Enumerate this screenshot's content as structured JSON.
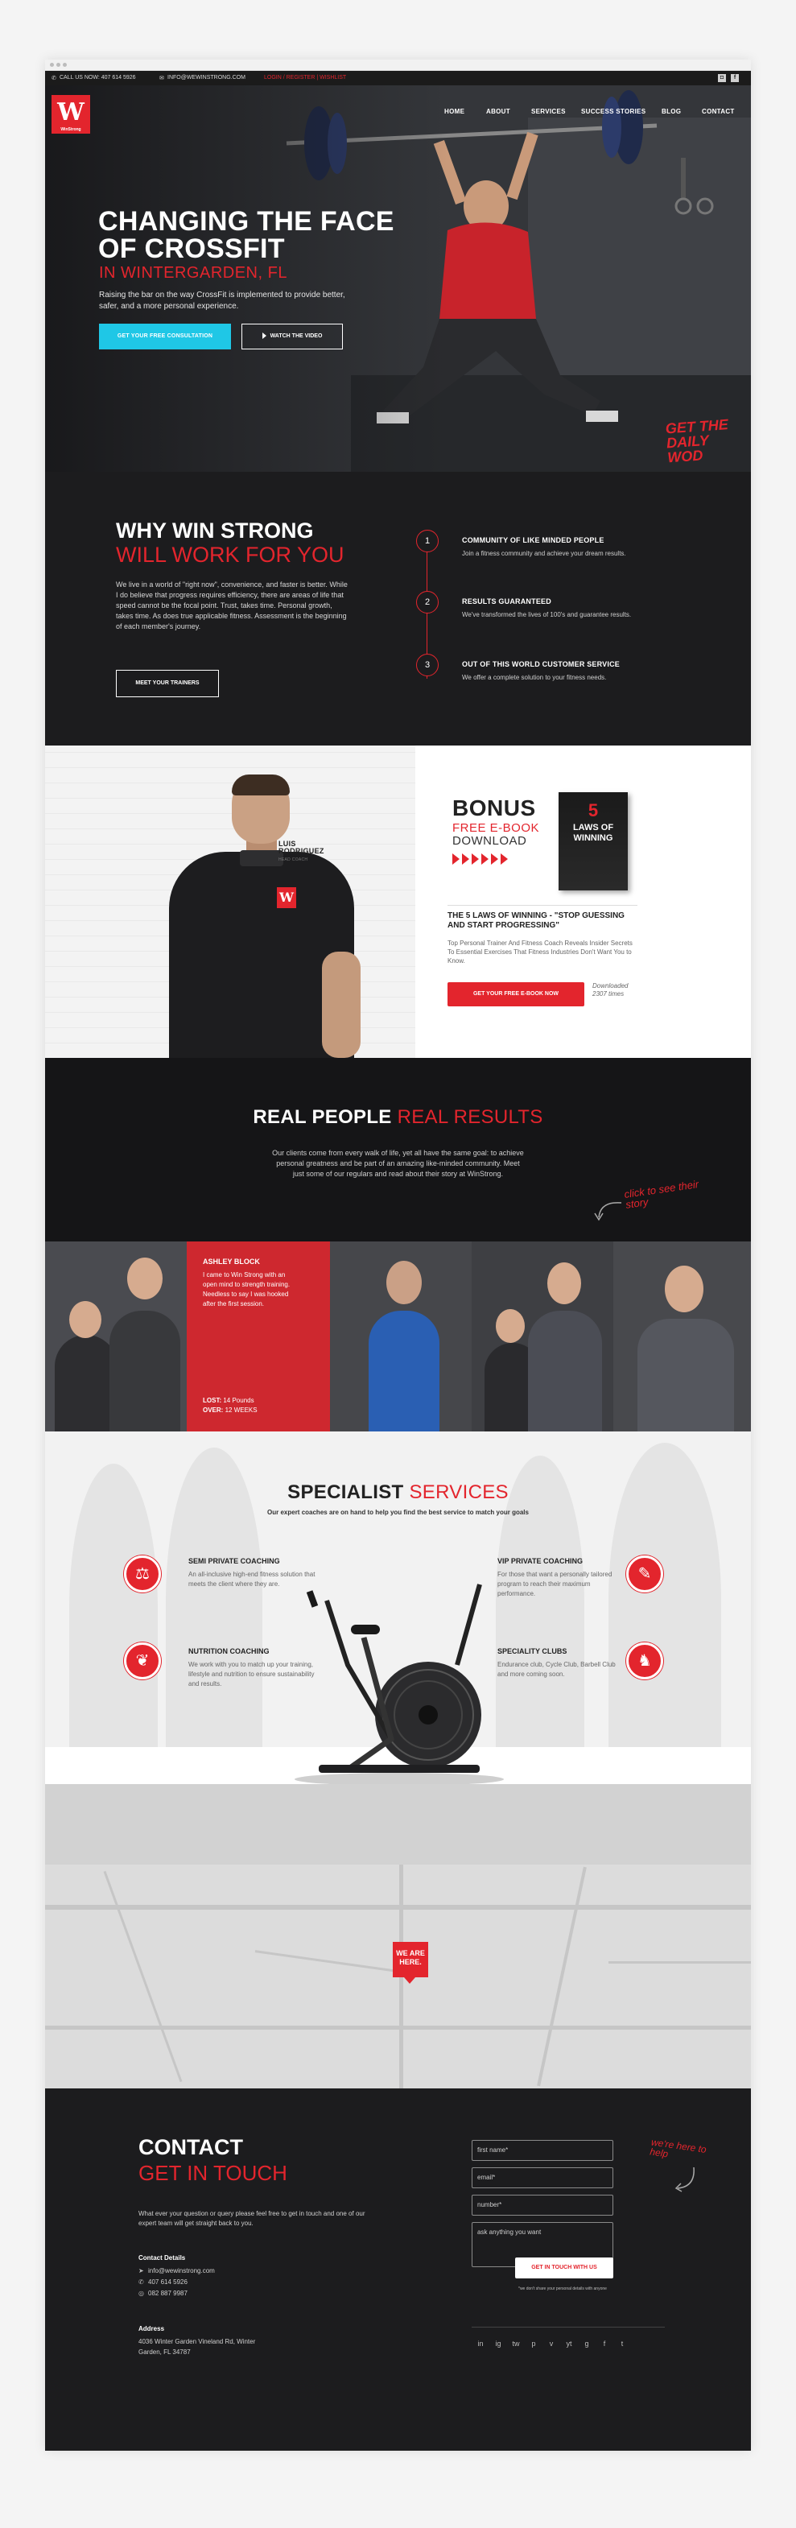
{
  "topbar": {
    "call": "CALL US NOW: 407 614 5926",
    "email": "INFO@WEWINSTRONG.COM",
    "links": "LOGIN / REGISTER | WISHLIST"
  },
  "logo": {
    "mark": "W",
    "text": "WinStrong"
  },
  "nav": [
    "HOME",
    "ABOUT",
    "SERVICES",
    "SUCCESS STORIES",
    "BLOG",
    "CONTACT"
  ],
  "hero": {
    "title": "CHANGING THE FACE OF CROSSFIT",
    "subtitle": "IN WINTERGARDEN, FL",
    "description": "Raising the bar on the way CrossFit is implemented to provide better, safer, and a more personal experience.",
    "cta_primary": "GET YOUR FREE CONSULTATION",
    "cta_secondary": "WATCH THE VIDEO",
    "wod": "GET THE DAILY WOD"
  },
  "why": {
    "title": "WHY WIN STRONG",
    "subtitle": "WILL WORK FOR YOU",
    "body": "We live in a world of \"right now\", convenience, and faster is better. While I do believe that progress requires efficiency, there are areas of life that speed cannot be the focal point. Trust, takes time. Personal growth, takes time. As does true applicable fitness. Assessment is the beginning of each member's journey.",
    "button": "MEET YOUR TRAINERS",
    "features": [
      {
        "num": "1",
        "title": "COMMUNITY OF LIKE MINDED PEOPLE",
        "text": "Join a fitness community and achieve your dream results."
      },
      {
        "num": "2",
        "title": "RESULTS GUARANTEED",
        "text": "We've transformed the lives of 100's and guarantee results."
      },
      {
        "num": "3",
        "title": "OUT OF THIS WORLD CUSTOMER SERVICE",
        "text": "We offer a complete solution to your fitness needs."
      }
    ]
  },
  "bonus": {
    "coach_first": "LUIS",
    "coach_last": "RODRIGUEZ",
    "coach_role": "HEAD COACH",
    "title": "BONUS",
    "free": "FREE E-BOOK",
    "download": "DOWNLOAD",
    "book_number": "5",
    "book_title": "LAWS OF WINNING",
    "heading": "THE 5 LAWS OF WINNING - \"STOP GUESSING AND START PROGRESSING\"",
    "text": "Top Personal Trainer And Fitness Coach Reveals Insider Secrets To Essential Exercises That Fitness Industries Don't Want You to Know.",
    "button": "GET YOUR FREE E-BOOK NOW",
    "downloaded": "Downloaded 2307 times"
  },
  "real": {
    "title_a": "REAL PEOPLE",
    "title_b": "REAL RESULTS",
    "text": "Our clients come from every walk of life, yet all have the same goal: to achieve personal greatness and be part of an amazing like-minded community. Meet just some of our regulars and read about their story at WinStrong.",
    "click": "click to see their story"
  },
  "story": {
    "name": "ASHLEY BLOCK",
    "text": "I came to Win Strong with an open mind to strength training. Needless to say I was hooked after the first session.",
    "lost_label": "LOST:",
    "lost_value": "14 Pounds",
    "over_label": "OVER:",
    "over_value": "12 WEEKS"
  },
  "services": {
    "title_a": "SPECIALIST",
    "title_b": "SERVICES",
    "intro": "Our expert coaches are on hand to help you find the best service to match your goals",
    "items": [
      {
        "title": "SEMI PRIVATE COACHING",
        "text": "An all-inclusive high-end fitness solution that meets the client where they are."
      },
      {
        "title": "NUTRITION COACHING",
        "text": "We work with you to match up your training, lifestyle and nutrition to ensure sustainability and results."
      },
      {
        "title": "VIP PRIVATE COACHING",
        "text": "For those that want a personally tailored program to reach their maximum performance."
      },
      {
        "title": "SPECIALITY CLUBS",
        "text": "Endurance club, Cycle Club, Barbell Club and more coming soon."
      }
    ]
  },
  "map": {
    "pin": "WE ARE HERE."
  },
  "contact": {
    "title": "CONTACT",
    "subtitle": "GET IN TOUCH",
    "intro": "What ever your question or query please feel free to get in touch and one of our expert team will get straight back to you.",
    "details_heading": "Contact Details",
    "email": "info@wewinstrong.com",
    "phone1": "407 614 5926",
    "phone2": "082 887 9987",
    "address_heading": "Address",
    "address": "4036 Winter Garden Vineland Rd, Winter Garden, FL 34787",
    "fields": {
      "first_name": "first name*",
      "email": "email*",
      "number": "number*",
      "message": "ask anything you want"
    },
    "button": "GET IN TOUCH WITH US",
    "note": "*we don't share your personal details with anyone",
    "help": "we're here to help",
    "socials": [
      "in",
      "ig",
      "tw",
      "p",
      "v",
      "yt",
      "g",
      "f",
      "t"
    ]
  },
  "colors": {
    "accent": "#e3252d",
    "cyan": "#1fc7e6",
    "dark": "#1c1c1e"
  }
}
